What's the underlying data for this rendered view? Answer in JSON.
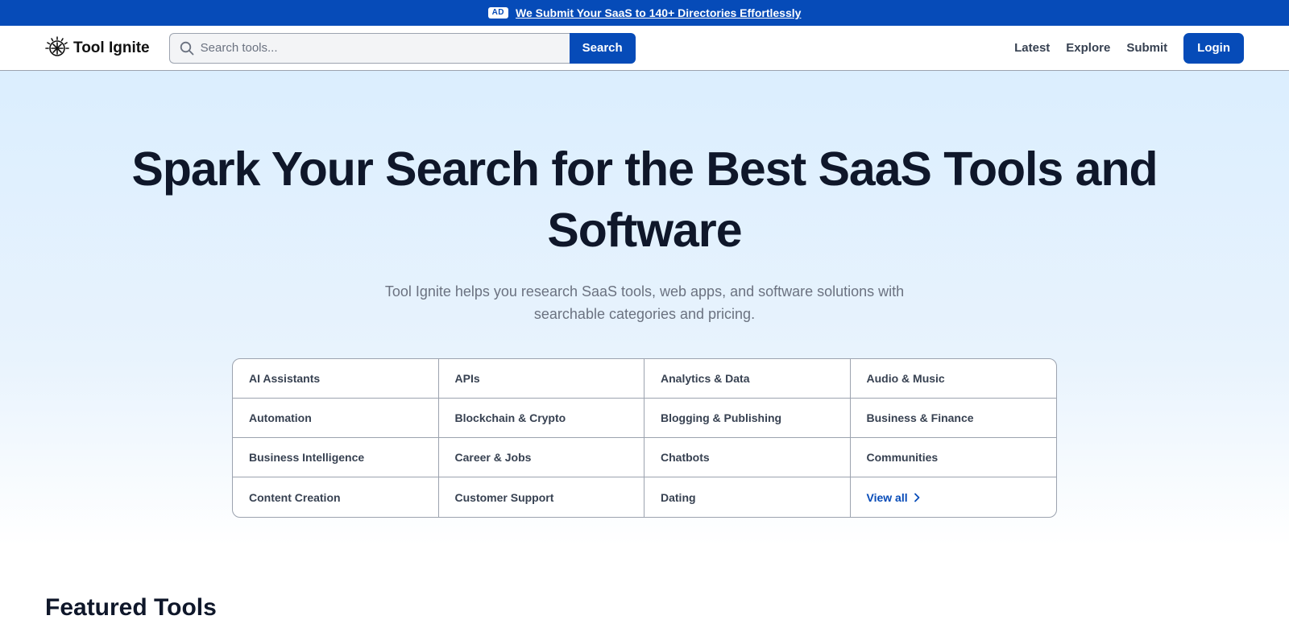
{
  "ad_bar": {
    "badge": "AD",
    "link_text": "We Submit Your SaaS to 140+ Directories Effortlessly"
  },
  "header": {
    "logo_text": "Tool Ignite",
    "search": {
      "placeholder": "Search tools...",
      "value": "",
      "button_label": "Search"
    },
    "nav": {
      "latest": "Latest",
      "explore": "Explore",
      "submit": "Submit"
    },
    "login_label": "Login"
  },
  "hero": {
    "title": "Spark Your Search for the Best SaaS Tools and Software",
    "subtitle": "Tool Ignite helps you research SaaS tools, web apps, and software solutions with searchable categories and pricing."
  },
  "categories": [
    "AI Assistants",
    "APIs",
    "Analytics & Data",
    "Audio & Music",
    "Automation",
    "Blockchain & Crypto",
    "Blogging & Publishing",
    "Business & Finance",
    "Business Intelligence",
    "Career & Jobs",
    "Chatbots",
    "Communities",
    "Content Creation",
    "Customer Support",
    "Dating"
  ],
  "view_all_label": "View all",
  "featured": {
    "title": "Featured Tools"
  },
  "colors": {
    "brand": "#064BB8",
    "heading": "#0f172a",
    "muted": "#6b7280",
    "border": "#9ca3af"
  }
}
